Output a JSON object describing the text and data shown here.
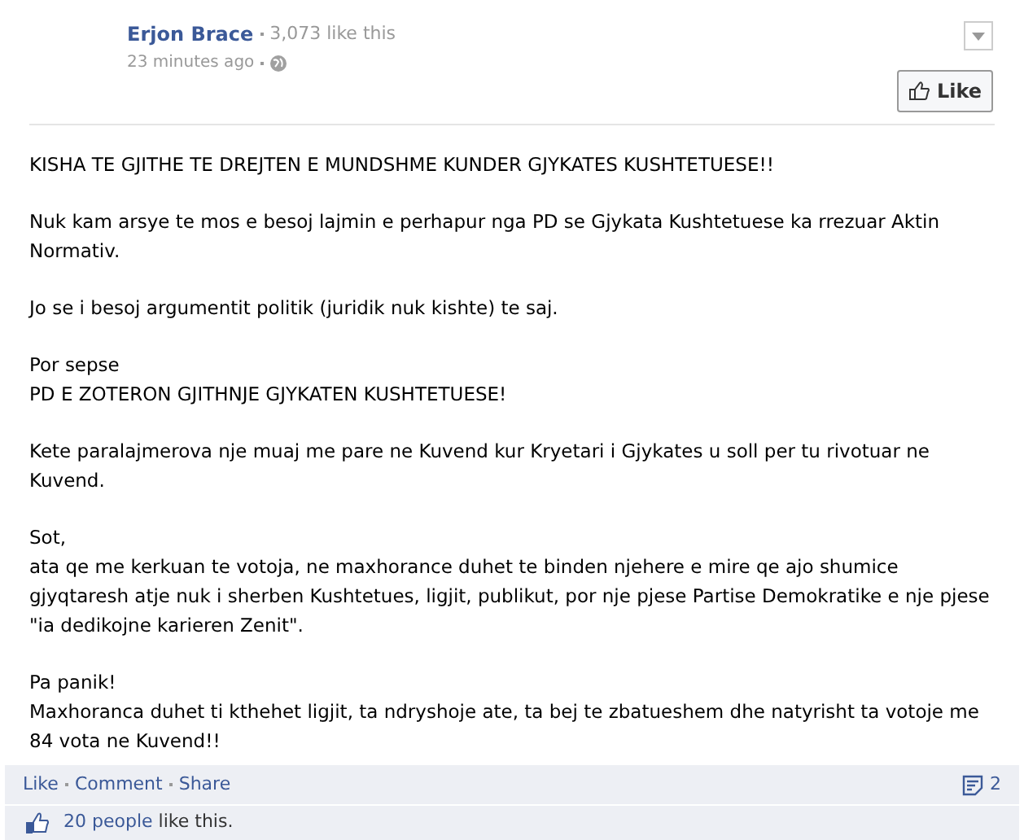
{
  "post": {
    "author": "Erjon Brace",
    "like_count": "3,073 like this",
    "time": "23 minutes ago",
    "like_button": "Like",
    "paragraphs": [
      [
        "KISHA TE GJITHE TE DREJTEN E MUNDSHME KUNDER GJYKATES KUSHTETUESE!!"
      ],
      [
        "Nuk kam arsye te mos e besoj lajmin e perhapur nga PD se Gjykata Kushtetuese ka rrezuar Aktin",
        "Normativ."
      ],
      [
        "Jo se i besoj argumentit politik (juridik nuk kishte) te saj."
      ],
      [
        "Por sepse",
        "PD E ZOTERON GJITHNJE GJYKATEN KUSHTETUESE!"
      ],
      [
        "Kete paralajmerova nje muaj me pare ne Kuvend kur Kryetari i Gjykates u soll per tu rivotuar ne",
        "Kuvend."
      ],
      [
        "Sot,",
        "ata qe me kerkuan te votoja, ne maxhorance duhet te binden njehere e mire qe ajo shumice",
        "gjyqtaresh atje nuk i sherben Kushtetues, ligjit, publikut, por nje pjese Partise Demokratike e nje pjese",
        "\"ia dedikojne karieren Zenit\"."
      ],
      [
        "Pa panik!",
        "Maxhoranca duhet ti kthehet ligjit, ta ndryshoje ate, ta bej te zbatueshem dhe natyrisht ta votoje me",
        "84 vota ne Kuvend!!"
      ]
    ]
  },
  "actions": [
    {
      "label": "Like"
    },
    {
      "label": "Comment"
    },
    {
      "label": "Share"
    }
  ],
  "comment_count": "2",
  "likes": {
    "link": "20 people",
    "text": "like this."
  }
}
